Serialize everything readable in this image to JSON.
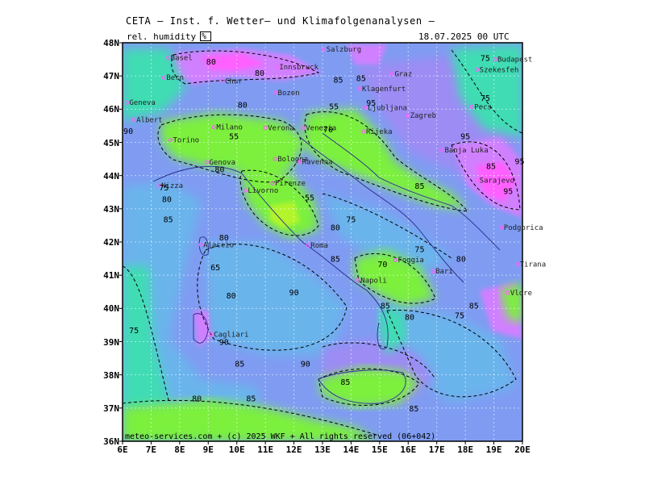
{
  "header": {
    "title": "CETA — Inst. f. Wetter— und Klimafolgenanalysen —",
    "parameter": "rel. humidity",
    "unit": "%",
    "valid_time": "18.07.2025 00 UTC"
  },
  "footer": {
    "credit": "meteo-services.com + (c) 2025 WKF + All rights reserved (06+042)"
  },
  "axes": {
    "lat_ticks": [
      "48N",
      "47N",
      "46N",
      "45N",
      "44N",
      "43N",
      "42N",
      "41N",
      "40N",
      "39N",
      "38N",
      "37N",
      "36N"
    ],
    "lon_ticks": [
      "6E",
      "7E",
      "8E",
      "9E",
      "10E",
      "11E",
      "12E",
      "13E",
      "14E",
      "15E",
      "16E",
      "17E",
      "18E",
      "19E",
      "20E"
    ]
  },
  "colors": {
    "very_dry": "#ff60ff",
    "dry": "#d080ff",
    "mid_low": "#9c8cf4",
    "mid": "#7f9cf2",
    "mid_high": "#6ab4ec",
    "humid": "#40dcb4",
    "very_humid": "#3cf0a0",
    "saturated": "#7cf03c",
    "near_sat": "#b4f42c",
    "frame": "#000000"
  },
  "cities": [
    {
      "name": "Basel",
      "lon": 7.6,
      "lat": 47.55
    },
    {
      "name": "Bern",
      "lon": 7.45,
      "lat": 46.95
    },
    {
      "name": "Geneva",
      "lon": 6.15,
      "lat": 46.2
    },
    {
      "name": "Albert",
      "lon": 6.4,
      "lat": 45.68
    },
    {
      "name": "Chur",
      "lon": 9.5,
      "lat": 46.85
    },
    {
      "name": "Bozen",
      "lon": 11.35,
      "lat": 46.5
    },
    {
      "name": "Milano",
      "lon": 9.2,
      "lat": 45.46
    },
    {
      "name": "Verona",
      "lon": 11.0,
      "lat": 45.44
    },
    {
      "name": "Venezia",
      "lon": 12.33,
      "lat": 45.44
    },
    {
      "name": "Torino",
      "lon": 7.68,
      "lat": 45.07
    },
    {
      "name": "Bologna",
      "lon": 11.34,
      "lat": 44.5
    },
    {
      "name": "Genova",
      "lon": 8.95,
      "lat": 44.41
    },
    {
      "name": "Ravenna",
      "lon": 12.2,
      "lat": 44.42
    },
    {
      "name": "Firenze",
      "lon": 11.25,
      "lat": 43.77
    },
    {
      "name": "Nizza",
      "lon": 7.27,
      "lat": 43.7
    },
    {
      "name": "Livorno",
      "lon": 10.3,
      "lat": 43.55
    },
    {
      "name": "Roma",
      "lon": 12.5,
      "lat": 41.9
    },
    {
      "name": "Ajaccio",
      "lon": 8.74,
      "lat": 41.92
    },
    {
      "name": "Napoli",
      "lon": 14.25,
      "lat": 40.85
    },
    {
      "name": "Foggia",
      "lon": 15.55,
      "lat": 41.46
    },
    {
      "name": "Bari",
      "lon": 16.87,
      "lat": 41.12
    },
    {
      "name": "Cagliari",
      "lon": 9.11,
      "lat": 39.22
    },
    {
      "name": "Salzburg",
      "lon": 13.05,
      "lat": 47.8
    },
    {
      "name": "Innsbruck",
      "lon": 11.4,
      "lat": 47.27
    },
    {
      "name": "Klagenfurt",
      "lon": 14.3,
      "lat": 46.62
    },
    {
      "name": "Ljubljana",
      "lon": 14.5,
      "lat": 46.05
    },
    {
      "name": "Zagreb",
      "lon": 15.98,
      "lat": 45.81
    },
    {
      "name": "Rijeka",
      "lon": 14.44,
      "lat": 45.33
    },
    {
      "name": "Banja Luka",
      "lon": 17.19,
      "lat": 44.77
    },
    {
      "name": "Sarajevo",
      "lon": 18.41,
      "lat": 43.86
    },
    {
      "name": "Podgorica",
      "lon": 19.26,
      "lat": 42.44
    },
    {
      "name": "Tirana",
      "lon": 19.82,
      "lat": 41.33
    },
    {
      "name": "Vlore",
      "lon": 19.49,
      "lat": 40.47
    },
    {
      "name": "Budapest",
      "lon": 19.04,
      "lat": 47.5
    },
    {
      "name": "Szekesfeh",
      "lon": 18.41,
      "lat": 47.19
    },
    {
      "name": "Pecs",
      "lon": 18.23,
      "lat": 46.07
    },
    {
      "name": "Graz",
      "lon": 15.44,
      "lat": 47.07
    }
  ],
  "contour_labels": [
    {
      "text": "80",
      "lon": 9.1,
      "lat": 47.35
    },
    {
      "text": "80",
      "lon": 10.8,
      "lat": 47.0
    },
    {
      "text": "75",
      "lon": 18.7,
      "lat": 47.45
    },
    {
      "text": "75",
      "lon": 18.7,
      "lat": 46.25
    },
    {
      "text": "80",
      "lon": 10.2,
      "lat": 46.05
    },
    {
      "text": "55",
      "lon": 13.4,
      "lat": 46.0
    },
    {
      "text": "70",
      "lon": 13.2,
      "lat": 45.3
    },
    {
      "text": "90",
      "lon": 6.2,
      "lat": 45.25
    },
    {
      "text": "85",
      "lon": 13.55,
      "lat": 46.8
    },
    {
      "text": "85",
      "lon": 14.35,
      "lat": 46.85
    },
    {
      "text": "95",
      "lon": 14.7,
      "lat": 46.1
    },
    {
      "text": "55",
      "lon": 9.9,
      "lat": 45.1
    },
    {
      "text": "80",
      "lon": 9.4,
      "lat": 44.1
    },
    {
      "text": "85",
      "lon": 16.4,
      "lat": 43.6
    },
    {
      "text": "55",
      "lon": 12.55,
      "lat": 43.25
    },
    {
      "text": "80",
      "lon": 7.55,
      "lat": 43.2
    },
    {
      "text": "75",
      "lon": 7.45,
      "lat": 43.55
    },
    {
      "text": "85",
      "lon": 7.6,
      "lat": 42.6
    },
    {
      "text": "80",
      "lon": 9.55,
      "lat": 42.05
    },
    {
      "text": "75",
      "lon": 14.0,
      "lat": 42.6
    },
    {
      "text": "80",
      "lon": 13.45,
      "lat": 42.35
    },
    {
      "text": "85",
      "lon": 13.45,
      "lat": 41.4
    },
    {
      "text": "75",
      "lon": 16.4,
      "lat": 41.7
    },
    {
      "text": "80",
      "lon": 17.85,
      "lat": 41.4
    },
    {
      "text": "70",
      "lon": 15.1,
      "lat": 41.25
    },
    {
      "text": "65",
      "lon": 9.25,
      "lat": 41.15
    },
    {
      "text": "90",
      "lon": 12.0,
      "lat": 40.4
    },
    {
      "text": "80",
      "lon": 9.8,
      "lat": 40.3
    },
    {
      "text": "85",
      "lon": 15.2,
      "lat": 40.0
    },
    {
      "text": "80",
      "lon": 16.05,
      "lat": 39.65
    },
    {
      "text": "85",
      "lon": 18.3,
      "lat": 40.0
    },
    {
      "text": "75",
      "lon": 17.8,
      "lat": 39.7
    },
    {
      "text": "75",
      "lon": 6.4,
      "lat": 39.25
    },
    {
      "text": "90",
      "lon": 9.55,
      "lat": 38.9
    },
    {
      "text": "85",
      "lon": 10.1,
      "lat": 38.25
    },
    {
      "text": "90",
      "lon": 12.4,
      "lat": 38.25
    },
    {
      "text": "85",
      "lon": 13.8,
      "lat": 37.7
    },
    {
      "text": "80",
      "lon": 8.6,
      "lat": 37.2
    },
    {
      "text": "85",
      "lon": 10.5,
      "lat": 37.2
    },
    {
      "text": "85",
      "lon": 16.2,
      "lat": 36.9
    },
    {
      "text": "95",
      "lon": 19.5,
      "lat": 43.45
    },
    {
      "text": "95",
      "lon": 19.9,
      "lat": 44.35
    },
    {
      "text": "95",
      "lon": 18.0,
      "lat": 45.1
    },
    {
      "text": "85",
      "lon": 18.9,
      "lat": 44.2
    }
  ]
}
